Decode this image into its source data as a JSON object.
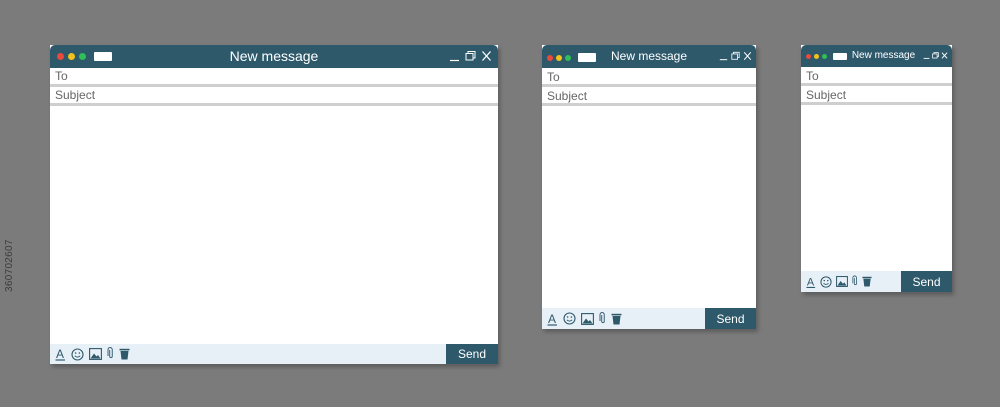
{
  "side_text": "360702607",
  "windows": [
    {
      "title": "New message",
      "to_label": "To",
      "subject_label": "Subject",
      "send_label": "Send",
      "icons": [
        "text-format-icon",
        "emoji-icon",
        "image-icon",
        "attachment-icon",
        "trash-icon"
      ],
      "window_controls": [
        "minimize-icon",
        "restore-icon",
        "close-icon"
      ],
      "traffic_lights": [
        "red",
        "yellow",
        "green"
      ]
    },
    {
      "title": "New message",
      "to_label": "To",
      "subject_label": "Subject",
      "send_label": "Send"
    },
    {
      "title": "New message",
      "to_label": "To",
      "subject_label": "Subject",
      "send_label": "Send"
    }
  ],
  "colors": {
    "background": "#7b7b7b",
    "titlebar": "#2e596b",
    "toolbar": "#e8f0f7",
    "dot_red": "#e84a3e",
    "dot_yellow": "#f2c21b",
    "dot_green": "#2fbf56"
  }
}
